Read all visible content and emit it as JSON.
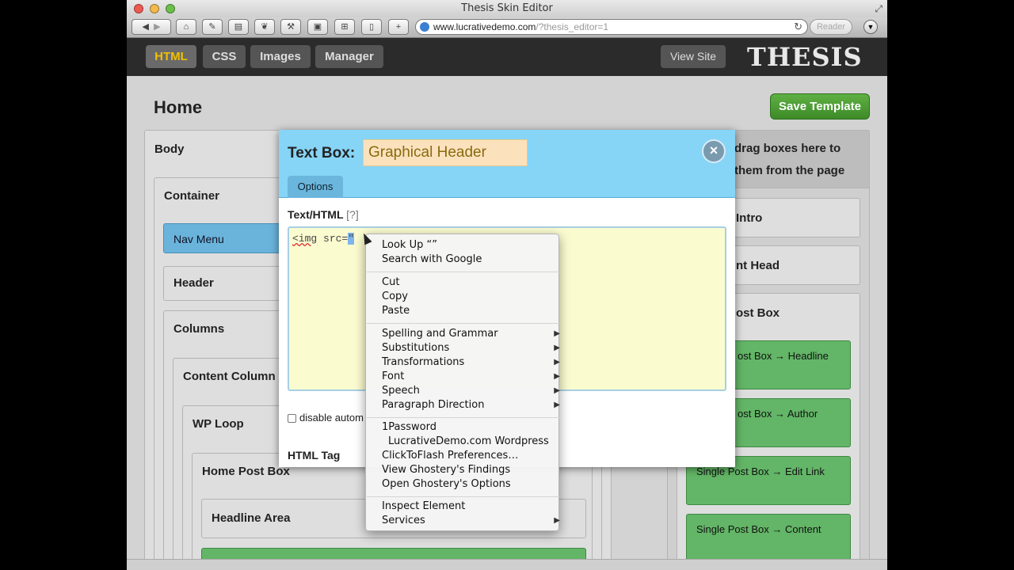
{
  "browser": {
    "title": "Thesis Skin Editor",
    "url_main": "www.lucrativedemo.com",
    "url_query": "/?thesis_editor=1",
    "reader_label": "Reader"
  },
  "nav": {
    "tabs": [
      {
        "label": "HTML",
        "active": true
      },
      {
        "label": "CSS",
        "active": false
      },
      {
        "label": "Images",
        "active": false
      },
      {
        "label": "Manager",
        "active": false
      }
    ],
    "view_site": "View Site",
    "logo": "THESIS"
  },
  "page": {
    "title": "Home",
    "save_button": "Save Template"
  },
  "left_boxes": {
    "body": "Body",
    "container": "Container",
    "nav_menu": "Nav Menu",
    "header": "Header",
    "columns": "Columns",
    "content_column": "Content Column",
    "wp_loop": "WP Loop",
    "home_post_box": "Home Post Box",
    "headline_area": "Headline Area"
  },
  "right_panel": {
    "drag_line1": "drag boxes here to",
    "drag_line2": "them from the page",
    "intro": "Intro",
    "content_head": "nt Head",
    "post_box": "ost Box",
    "headline": "ost Box → Headline",
    "author": "ost Box → Author",
    "edit_link": "Single Post Box → Edit Link",
    "content": "Single Post Box → Content"
  },
  "modal": {
    "title": "Text Box:",
    "name_value": "Graphical Header",
    "close_icon": "×",
    "options_tab": "Options",
    "field_label": "Text/HTML",
    "field_help": "[?]",
    "code_tag": "<img",
    "code_attr": " src=",
    "code_sel": "\"",
    "checkbox_label": "disable autom",
    "html_tag_label": "HTML Tag"
  },
  "context_menu": {
    "look_up": "Look Up “”",
    "search_google": "Search with Google",
    "cut": "Cut",
    "copy": "Copy",
    "paste": "Paste",
    "spelling": "Spelling and Grammar",
    "substitutions": "Substitutions",
    "transformations": "Transformations",
    "font": "Font",
    "speech": "Speech",
    "paragraph_direction": "Paragraph Direction",
    "onepassword": "1Password",
    "lucrative_wp": "LucrativeDemo.com Wordpress",
    "clicktoflash": "ClickToFlash Preferences…",
    "ghostery_findings": "View Ghostery's Findings",
    "ghostery_options": "Open Ghostery's Options",
    "inspect": "Inspect Element",
    "services": "Services",
    "submenu_arrow": "▶"
  }
}
